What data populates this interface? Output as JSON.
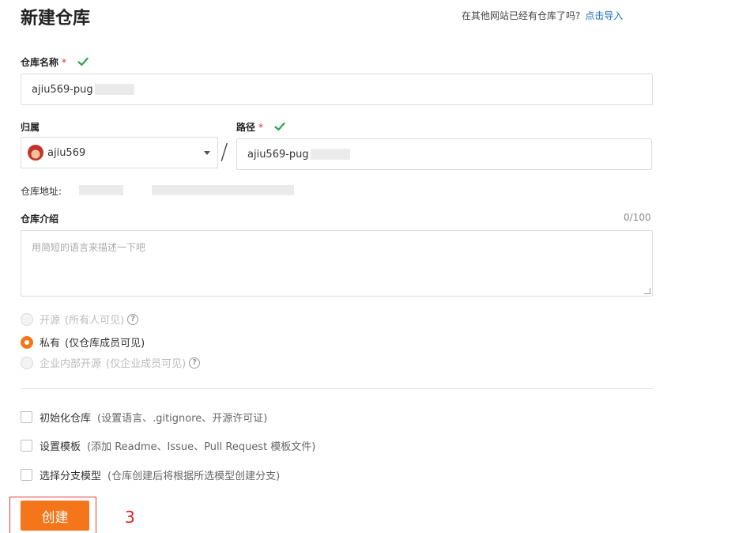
{
  "header": {
    "title": "新建仓库",
    "import_hint": "在其他网站已经有仓库了吗?",
    "import_link": "点击导入"
  },
  "repo_name": {
    "label": "仓库名称",
    "required_mark": "*",
    "value": "ajiu569-pug"
  },
  "owner": {
    "label": "归属",
    "value": "ajiu569"
  },
  "path": {
    "label": "路径",
    "required_mark": "*",
    "slash": "/",
    "value": "ajiu569-pug"
  },
  "address": {
    "label": "仓库地址:"
  },
  "description": {
    "label": "仓库介绍",
    "counter": "0/100",
    "placeholder": "用简短的语言来描述一下吧"
  },
  "visibility": [
    {
      "label": "开源",
      "note": "(所有人可见)",
      "selected": false,
      "disabled": true,
      "help_icon": "question-circle-icon"
    },
    {
      "label": "私有",
      "note": "(仅仓库成员可见)",
      "selected": true,
      "disabled": false
    },
    {
      "label": "企业内部开源",
      "note": "(仅企业成员可见)",
      "selected": false,
      "disabled": true,
      "help_icon": "question-circle-icon"
    }
  ],
  "options": [
    {
      "label": "初始化仓库",
      "note": "(设置语言、.gitignore、开源许可证)",
      "checked": false
    },
    {
      "label": "设置模板",
      "note": "(添加 Readme、Issue、Pull Request 模板文件)",
      "checked": false
    },
    {
      "label": "选择分支模型",
      "note": "(仓库创建后将根据所选模型创建分支)",
      "checked": false
    }
  ],
  "submit": {
    "label": "创建"
  },
  "annotation": {
    "step": "3"
  },
  "colors": {
    "accent": "#f5761a",
    "link": "#1a6fb4",
    "valid": "#2da44e",
    "required": "#e12b2b",
    "annotation": "#e02020"
  }
}
